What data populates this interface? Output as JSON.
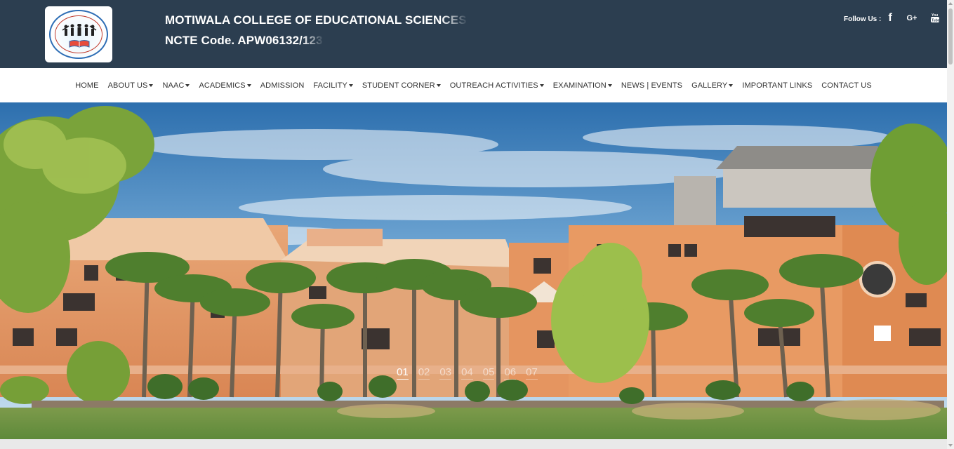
{
  "header": {
    "title_line1_solid": "MOTIWALA COLLEGE OF EDUCATIONAL SCIEN",
    "title_line1_fade": "CES",
    "title_line2_solid": "NCTE Code. APW06132/",
    "title_line2_fade": "123",
    "logo_alt": "Motiwala College of Educational Sciences seal",
    "follow_label": "Follow Us :",
    "social": [
      {
        "name": "facebook-icon",
        "glyph": "f"
      },
      {
        "name": "google-plus-icon",
        "glyph": "G+"
      },
      {
        "name": "youtube-icon",
        "glyph": "You"
      }
    ],
    "colors": {
      "header_bg": "#2c3e50",
      "title": "#ffffff"
    }
  },
  "nav": {
    "items": [
      {
        "label": "HOME",
        "dropdown": false
      },
      {
        "label": "ABOUT US",
        "dropdown": true
      },
      {
        "label": "NAAC",
        "dropdown": true
      },
      {
        "label": "ACADEMICS",
        "dropdown": true
      },
      {
        "label": "ADMISSION",
        "dropdown": false
      },
      {
        "label": "FACILITY",
        "dropdown": true
      },
      {
        "label": "STUDENT CORNER",
        "dropdown": true
      },
      {
        "label": "OUTREACH ACTIVITIES",
        "dropdown": true
      },
      {
        "label": "EXAMINATION",
        "dropdown": true
      },
      {
        "label": "NEWS | EVENTS",
        "dropdown": false
      },
      {
        "label": "GALLERY",
        "dropdown": true
      },
      {
        "label": "IMPORTANT LINKS",
        "dropdown": false
      },
      {
        "label": "CONTACT US",
        "dropdown": false
      }
    ]
  },
  "hero": {
    "image_subject": "college campus building with palm trees under blue sky",
    "indicators": [
      "01",
      "02",
      "03",
      "04",
      "05",
      "06",
      "07"
    ],
    "active_indicator": 0
  }
}
